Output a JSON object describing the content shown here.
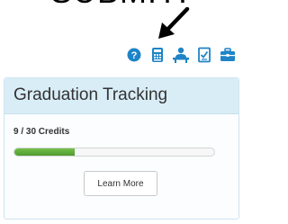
{
  "caption": "SUBMIT!",
  "toolbar": {
    "icons": [
      {
        "name": "help-icon",
        "color": "#1e84c7"
      },
      {
        "name": "calculator-icon",
        "color": "#1e84c7"
      },
      {
        "name": "advisor-icon",
        "color": "#1e84c7"
      },
      {
        "name": "checklist-icon",
        "color": "#1e84c7"
      },
      {
        "name": "briefcase-icon",
        "color": "#1e84c7"
      }
    ]
  },
  "graduation": {
    "title": "Graduation Tracking",
    "credits_text": "9 / 30 Credits",
    "credits_earned": 9,
    "credits_required": 30,
    "progress_fraction": 0.3,
    "button_label": "Learn More"
  },
  "colors": {
    "icon_blue": "#1e84c7",
    "header_bg": "#d9edf7",
    "progress_green": "#5aa838"
  }
}
